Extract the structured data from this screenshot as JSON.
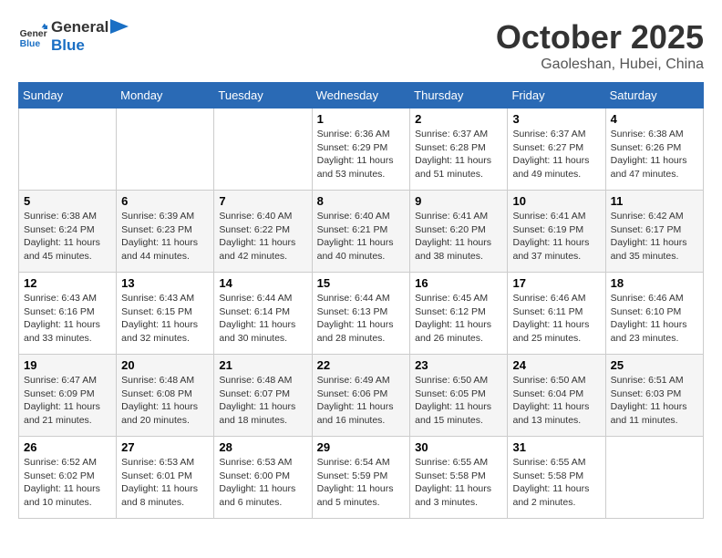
{
  "header": {
    "logo_line1": "General",
    "logo_line2": "Blue",
    "month": "October 2025",
    "location": "Gaoleshan, Hubei, China"
  },
  "weekdays": [
    "Sunday",
    "Monday",
    "Tuesday",
    "Wednesday",
    "Thursday",
    "Friday",
    "Saturday"
  ],
  "weeks": [
    [
      {
        "day": "",
        "sunrise": "",
        "sunset": "",
        "daylight": ""
      },
      {
        "day": "",
        "sunrise": "",
        "sunset": "",
        "daylight": ""
      },
      {
        "day": "",
        "sunrise": "",
        "sunset": "",
        "daylight": ""
      },
      {
        "day": "1",
        "sunrise": "Sunrise: 6:36 AM",
        "sunset": "Sunset: 6:29 PM",
        "daylight": "Daylight: 11 hours and 53 minutes."
      },
      {
        "day": "2",
        "sunrise": "Sunrise: 6:37 AM",
        "sunset": "Sunset: 6:28 PM",
        "daylight": "Daylight: 11 hours and 51 minutes."
      },
      {
        "day": "3",
        "sunrise": "Sunrise: 6:37 AM",
        "sunset": "Sunset: 6:27 PM",
        "daylight": "Daylight: 11 hours and 49 minutes."
      },
      {
        "day": "4",
        "sunrise": "Sunrise: 6:38 AM",
        "sunset": "Sunset: 6:26 PM",
        "daylight": "Daylight: 11 hours and 47 minutes."
      }
    ],
    [
      {
        "day": "5",
        "sunrise": "Sunrise: 6:38 AM",
        "sunset": "Sunset: 6:24 PM",
        "daylight": "Daylight: 11 hours and 45 minutes."
      },
      {
        "day": "6",
        "sunrise": "Sunrise: 6:39 AM",
        "sunset": "Sunset: 6:23 PM",
        "daylight": "Daylight: 11 hours and 44 minutes."
      },
      {
        "day": "7",
        "sunrise": "Sunrise: 6:40 AM",
        "sunset": "Sunset: 6:22 PM",
        "daylight": "Daylight: 11 hours and 42 minutes."
      },
      {
        "day": "8",
        "sunrise": "Sunrise: 6:40 AM",
        "sunset": "Sunset: 6:21 PM",
        "daylight": "Daylight: 11 hours and 40 minutes."
      },
      {
        "day": "9",
        "sunrise": "Sunrise: 6:41 AM",
        "sunset": "Sunset: 6:20 PM",
        "daylight": "Daylight: 11 hours and 38 minutes."
      },
      {
        "day": "10",
        "sunrise": "Sunrise: 6:41 AM",
        "sunset": "Sunset: 6:19 PM",
        "daylight": "Daylight: 11 hours and 37 minutes."
      },
      {
        "day": "11",
        "sunrise": "Sunrise: 6:42 AM",
        "sunset": "Sunset: 6:17 PM",
        "daylight": "Daylight: 11 hours and 35 minutes."
      }
    ],
    [
      {
        "day": "12",
        "sunrise": "Sunrise: 6:43 AM",
        "sunset": "Sunset: 6:16 PM",
        "daylight": "Daylight: 11 hours and 33 minutes."
      },
      {
        "day": "13",
        "sunrise": "Sunrise: 6:43 AM",
        "sunset": "Sunset: 6:15 PM",
        "daylight": "Daylight: 11 hours and 32 minutes."
      },
      {
        "day": "14",
        "sunrise": "Sunrise: 6:44 AM",
        "sunset": "Sunset: 6:14 PM",
        "daylight": "Daylight: 11 hours and 30 minutes."
      },
      {
        "day": "15",
        "sunrise": "Sunrise: 6:44 AM",
        "sunset": "Sunset: 6:13 PM",
        "daylight": "Daylight: 11 hours and 28 minutes."
      },
      {
        "day": "16",
        "sunrise": "Sunrise: 6:45 AM",
        "sunset": "Sunset: 6:12 PM",
        "daylight": "Daylight: 11 hours and 26 minutes."
      },
      {
        "day": "17",
        "sunrise": "Sunrise: 6:46 AM",
        "sunset": "Sunset: 6:11 PM",
        "daylight": "Daylight: 11 hours and 25 minutes."
      },
      {
        "day": "18",
        "sunrise": "Sunrise: 6:46 AM",
        "sunset": "Sunset: 6:10 PM",
        "daylight": "Daylight: 11 hours and 23 minutes."
      }
    ],
    [
      {
        "day": "19",
        "sunrise": "Sunrise: 6:47 AM",
        "sunset": "Sunset: 6:09 PM",
        "daylight": "Daylight: 11 hours and 21 minutes."
      },
      {
        "day": "20",
        "sunrise": "Sunrise: 6:48 AM",
        "sunset": "Sunset: 6:08 PM",
        "daylight": "Daylight: 11 hours and 20 minutes."
      },
      {
        "day": "21",
        "sunrise": "Sunrise: 6:48 AM",
        "sunset": "Sunset: 6:07 PM",
        "daylight": "Daylight: 11 hours and 18 minutes."
      },
      {
        "day": "22",
        "sunrise": "Sunrise: 6:49 AM",
        "sunset": "Sunset: 6:06 PM",
        "daylight": "Daylight: 11 hours and 16 minutes."
      },
      {
        "day": "23",
        "sunrise": "Sunrise: 6:50 AM",
        "sunset": "Sunset: 6:05 PM",
        "daylight": "Daylight: 11 hours and 15 minutes."
      },
      {
        "day": "24",
        "sunrise": "Sunrise: 6:50 AM",
        "sunset": "Sunset: 6:04 PM",
        "daylight": "Daylight: 11 hours and 13 minutes."
      },
      {
        "day": "25",
        "sunrise": "Sunrise: 6:51 AM",
        "sunset": "Sunset: 6:03 PM",
        "daylight": "Daylight: 11 hours and 11 minutes."
      }
    ],
    [
      {
        "day": "26",
        "sunrise": "Sunrise: 6:52 AM",
        "sunset": "Sunset: 6:02 PM",
        "daylight": "Daylight: 11 hours and 10 minutes."
      },
      {
        "day": "27",
        "sunrise": "Sunrise: 6:53 AM",
        "sunset": "Sunset: 6:01 PM",
        "daylight": "Daylight: 11 hours and 8 minutes."
      },
      {
        "day": "28",
        "sunrise": "Sunrise: 6:53 AM",
        "sunset": "Sunset: 6:00 PM",
        "daylight": "Daylight: 11 hours and 6 minutes."
      },
      {
        "day": "29",
        "sunrise": "Sunrise: 6:54 AM",
        "sunset": "Sunset: 5:59 PM",
        "daylight": "Daylight: 11 hours and 5 minutes."
      },
      {
        "day": "30",
        "sunrise": "Sunrise: 6:55 AM",
        "sunset": "Sunset: 5:58 PM",
        "daylight": "Daylight: 11 hours and 3 minutes."
      },
      {
        "day": "31",
        "sunrise": "Sunrise: 6:55 AM",
        "sunset": "Sunset: 5:58 PM",
        "daylight": "Daylight: 11 hours and 2 minutes."
      },
      {
        "day": "",
        "sunrise": "",
        "sunset": "",
        "daylight": ""
      }
    ]
  ]
}
